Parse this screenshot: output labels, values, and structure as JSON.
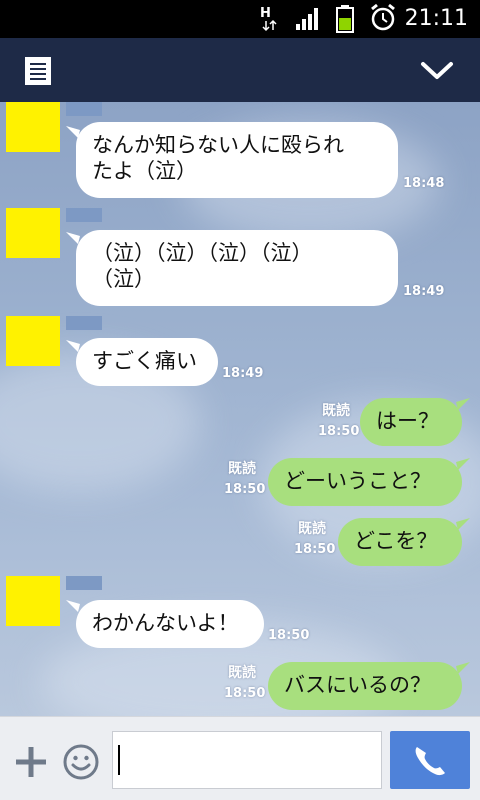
{
  "status_bar": {
    "time": "21:11",
    "network": "H",
    "icons": [
      "network-h-icon",
      "signal-icon",
      "battery-icon",
      "alarm-icon"
    ]
  },
  "header": {
    "icons": [
      "menu-list-icon",
      "chevron-down-icon"
    ]
  },
  "messages": [
    {
      "side": "in",
      "text": "なんか知らない人に殴られ\nたよ（泣）",
      "time": "18:48"
    },
    {
      "side": "in",
      "text": "（泣）（泣）（泣）（泣）\n（泣）",
      "time": "18:49"
    },
    {
      "side": "in",
      "text": "すごく痛い",
      "time": "18:49"
    },
    {
      "side": "out",
      "text": "はー？",
      "read": "既読",
      "time": "18:50"
    },
    {
      "side": "out",
      "text": "どーいうこと？",
      "read": "既読",
      "time": "18:50"
    },
    {
      "side": "out",
      "text": "どこを？",
      "read": "既読",
      "time": "18:50"
    },
    {
      "side": "in",
      "text": "わかんないよ！",
      "time": "18:50"
    },
    {
      "side": "out",
      "text": "バスにいるの？",
      "read": "既読",
      "time": "18:50"
    }
  ],
  "input_bar": {
    "value": "",
    "icons": [
      "plus-icon",
      "emoji-icon",
      "phone-icon"
    ]
  },
  "colors": {
    "header": "#1e2a47",
    "bubble_out": "#a8df7e",
    "bubble_in": "#ffffff",
    "call_button": "#4f82d9",
    "avatar": "#fff200"
  }
}
